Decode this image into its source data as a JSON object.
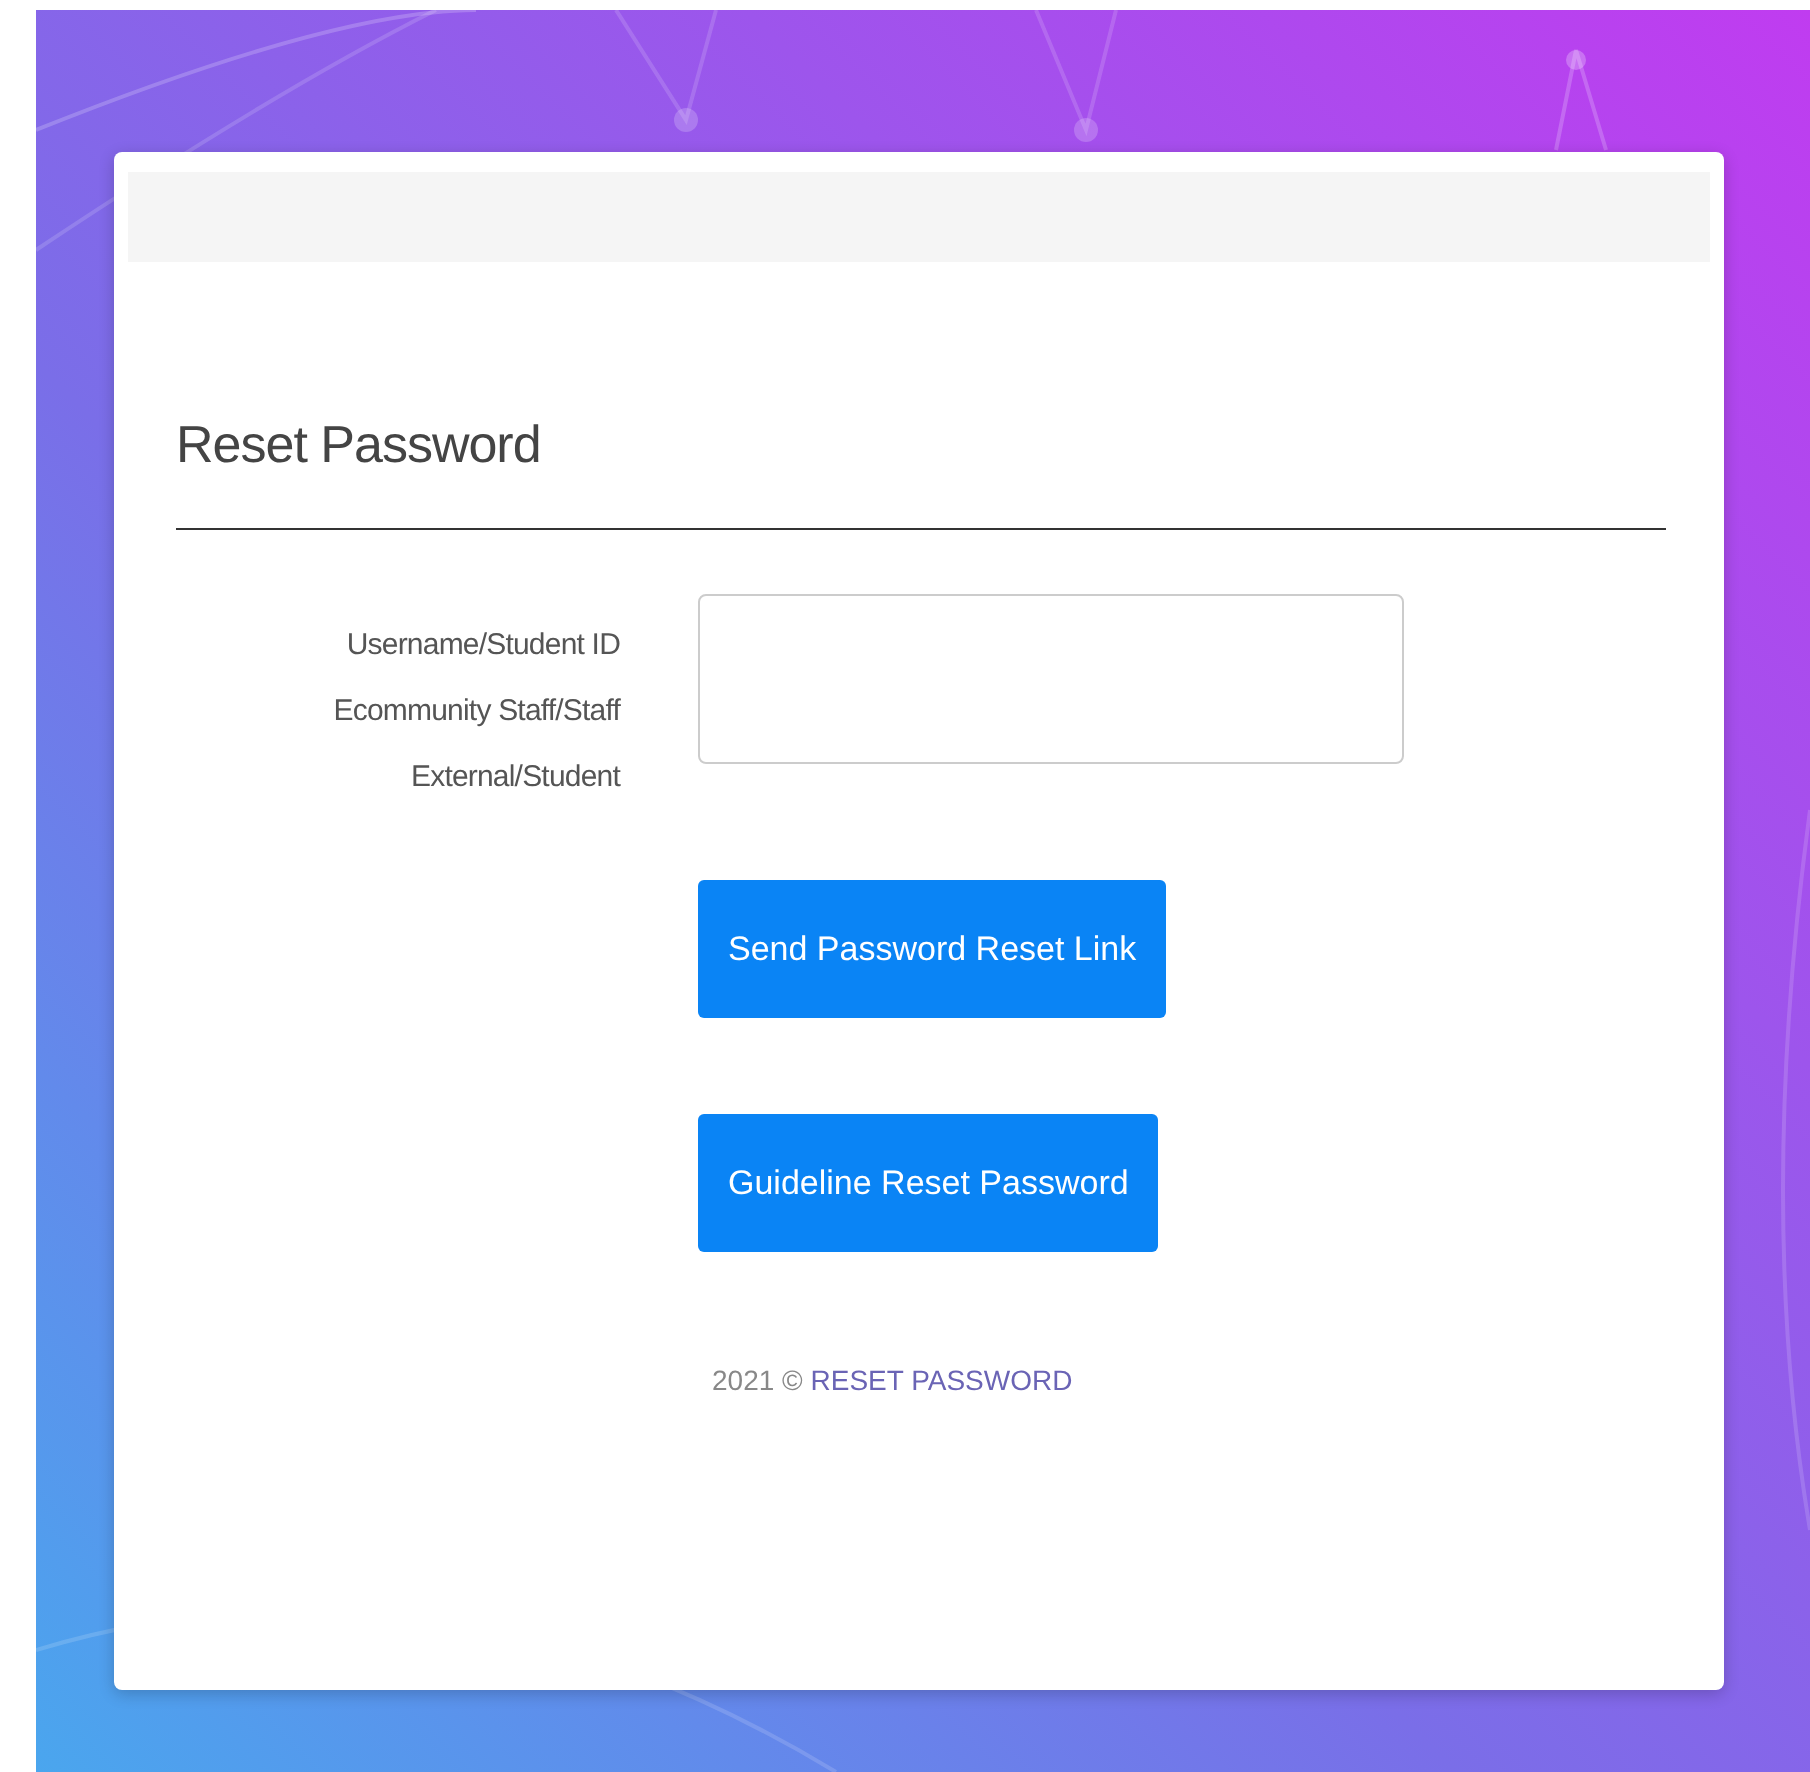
{
  "title": "Reset Password",
  "form": {
    "label_lines": [
      "Username/Student ID",
      "Ecommunity Staff/Staff",
      "External/Student"
    ]
  },
  "buttons": [
    "Send Password Reset Link",
    "Guideline Reset Password"
  ],
  "footer": {
    "year": "2021 ©",
    "link": "RESET PASSWORD"
  }
}
